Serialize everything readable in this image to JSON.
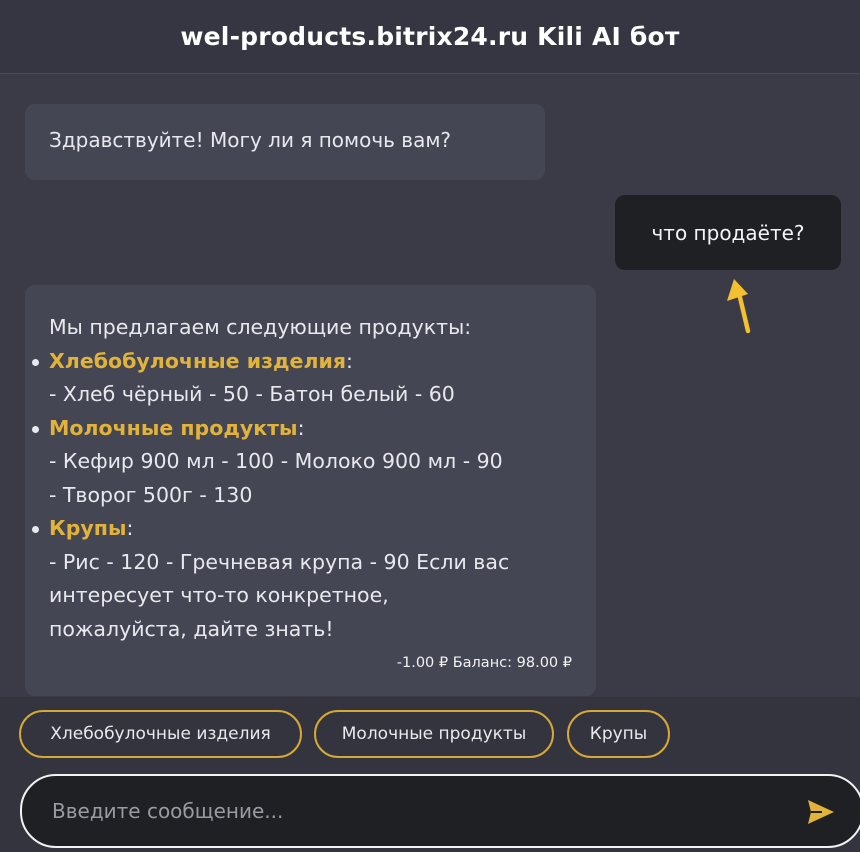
{
  "header": {
    "title": "wel-products.bitrix24.ru Kili AI бот"
  },
  "messages": {
    "greeting": "Здравствуйте! Могу ли я помочь вам?",
    "user": "что продаёте?",
    "bot": {
      "intro": "Мы предлагаем следующие продукты:",
      "categories": [
        {
          "name": "Хлебобулочные изделия",
          "lines": [
            "- Хлеб чёрный - 50 - Батон белый - 60"
          ]
        },
        {
          "name": "Молочные продукты",
          "lines": [
            "- Кефир 900 мл - 100 - Молоко 900 мл - 90",
            "- Творог 500г - 130"
          ]
        },
        {
          "name": "Крупы",
          "lines": [
            "- Рис - 120 - Гречневая крупа - 90 Если вас",
            "интересует что-то конкретное,",
            "пожалуйста, дайте знать!"
          ]
        }
      ],
      "balance": "-1.00 ₽ Баланс: 98.00 ₽"
    }
  },
  "quick_replies": [
    "Хлебобулочные изделия",
    "Молочные продукты",
    "Крупы"
  ],
  "composer": {
    "placeholder": "Введите сообщение..."
  },
  "colors": {
    "accent": "#e2b33a",
    "background": "#3a3b46",
    "bubble": "#454653",
    "user_bubble": "#1f2024"
  },
  "icons": {
    "send": "send-icon",
    "pointer": "arrow-up-icon"
  }
}
